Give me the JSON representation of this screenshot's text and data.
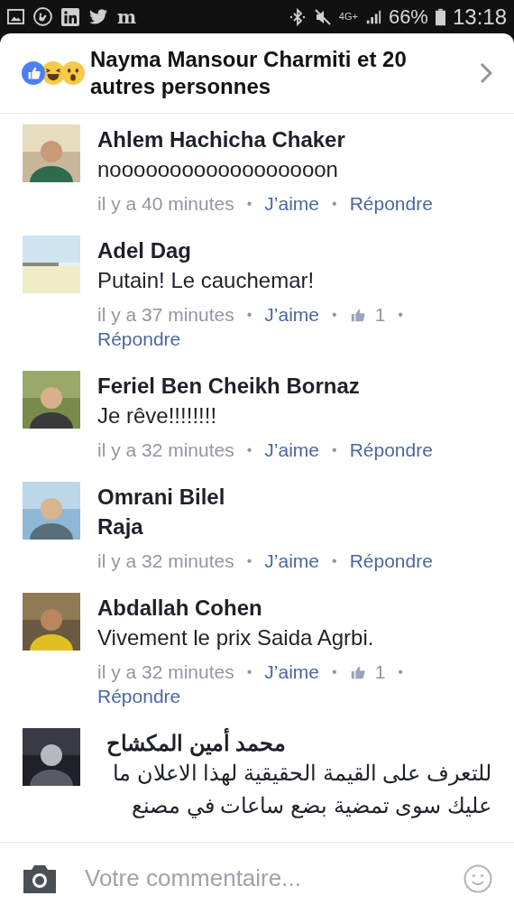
{
  "status_bar": {
    "notification_letter": "m",
    "network": "4G+",
    "battery": "66%",
    "time": "13:18"
  },
  "reactions_header": {
    "reactions": [
      {
        "kind": "like",
        "color": "#4a80f0"
      },
      {
        "kind": "haha",
        "color": "#f7c948"
      },
      {
        "kind": "wow",
        "color": "#f7c948"
      }
    ],
    "text": "Nayma Mansour Charmiti et 20 autres personnes"
  },
  "comments": [
    {
      "avatar": {
        "kind": "picture"
      },
      "name": "Ahlem Hachicha Chaker",
      "lines": [
        "noooooooooooooooooon"
      ],
      "mention": false,
      "rtl": false,
      "meta": [
        {
          "kind": "time",
          "text": "il y a 40 minutes"
        },
        {
          "kind": "separator",
          "text": "•"
        },
        {
          "kind": "like",
          "text": "J’aime"
        },
        {
          "kind": "separator",
          "text": "•"
        },
        {
          "kind": "reply",
          "text": "Répondre"
        }
      ]
    },
    {
      "avatar": {
        "kind": "picture"
      },
      "name": "Adel Dag",
      "lines": [
        "Putain! Le cauchemar!"
      ],
      "mention": false,
      "rtl": false,
      "meta": [
        {
          "kind": "time",
          "text": "il y a 37 minutes"
        },
        {
          "kind": "separator",
          "text": "•"
        },
        {
          "kind": "like",
          "text": "J’aime"
        },
        {
          "kind": "separator",
          "text": "•"
        },
        {
          "kind": "like_count",
          "text": "1"
        },
        {
          "kind": "separator",
          "text": "•"
        },
        {
          "kind": "reply",
          "text": "Répondre"
        }
      ]
    },
    {
      "avatar": {
        "kind": "picture"
      },
      "name": "Feriel Ben Cheikh Bornaz",
      "lines": [
        "Je rêve!!!!!!!!"
      ],
      "mention": false,
      "rtl": false,
      "meta": [
        {
          "kind": "time",
          "text": "il y a 32 minutes"
        },
        {
          "kind": "separator",
          "text": "•"
        },
        {
          "kind": "like",
          "text": "J’aime"
        },
        {
          "kind": "separator",
          "text": "•"
        },
        {
          "kind": "reply",
          "text": "Répondre"
        }
      ]
    },
    {
      "avatar": {
        "kind": "picture"
      },
      "name": "Omrani Bilel",
      "lines": [
        "Raja"
      ],
      "mention": true,
      "rtl": false,
      "meta": [
        {
          "kind": "time",
          "text": "il y a 32 minutes"
        },
        {
          "kind": "separator",
          "text": "•"
        },
        {
          "kind": "like",
          "text": "J’aime"
        },
        {
          "kind": "separator",
          "text": "•"
        },
        {
          "kind": "reply",
          "text": "Répondre"
        }
      ]
    },
    {
      "avatar": {
        "kind": "picture"
      },
      "name": "Abdallah Cohen",
      "lines": [
        "Vivement le prix Saida Agrbi."
      ],
      "mention": false,
      "rtl": false,
      "meta": [
        {
          "kind": "time",
          "text": "il y a 32 minutes"
        },
        {
          "kind": "separator",
          "text": "•"
        },
        {
          "kind": "like",
          "text": "J’aime"
        },
        {
          "kind": "separator",
          "text": "•"
        },
        {
          "kind": "like_count",
          "text": "1"
        },
        {
          "kind": "separator",
          "text": "•"
        },
        {
          "kind": "reply",
          "text": "Répondre"
        }
      ]
    },
    {
      "avatar": {
        "kind": "picture"
      },
      "name": "محمد أمين المكشاح",
      "lines": [
        "للتعرف على القيمة الحقيقية لهذا الاعلان ما",
        "عليك سوى تمضية بضع ساعات في مصنع"
      ],
      "mention": false,
      "rtl": true
    }
  ],
  "composer": {
    "placeholder": "Votre commentaire..."
  }
}
